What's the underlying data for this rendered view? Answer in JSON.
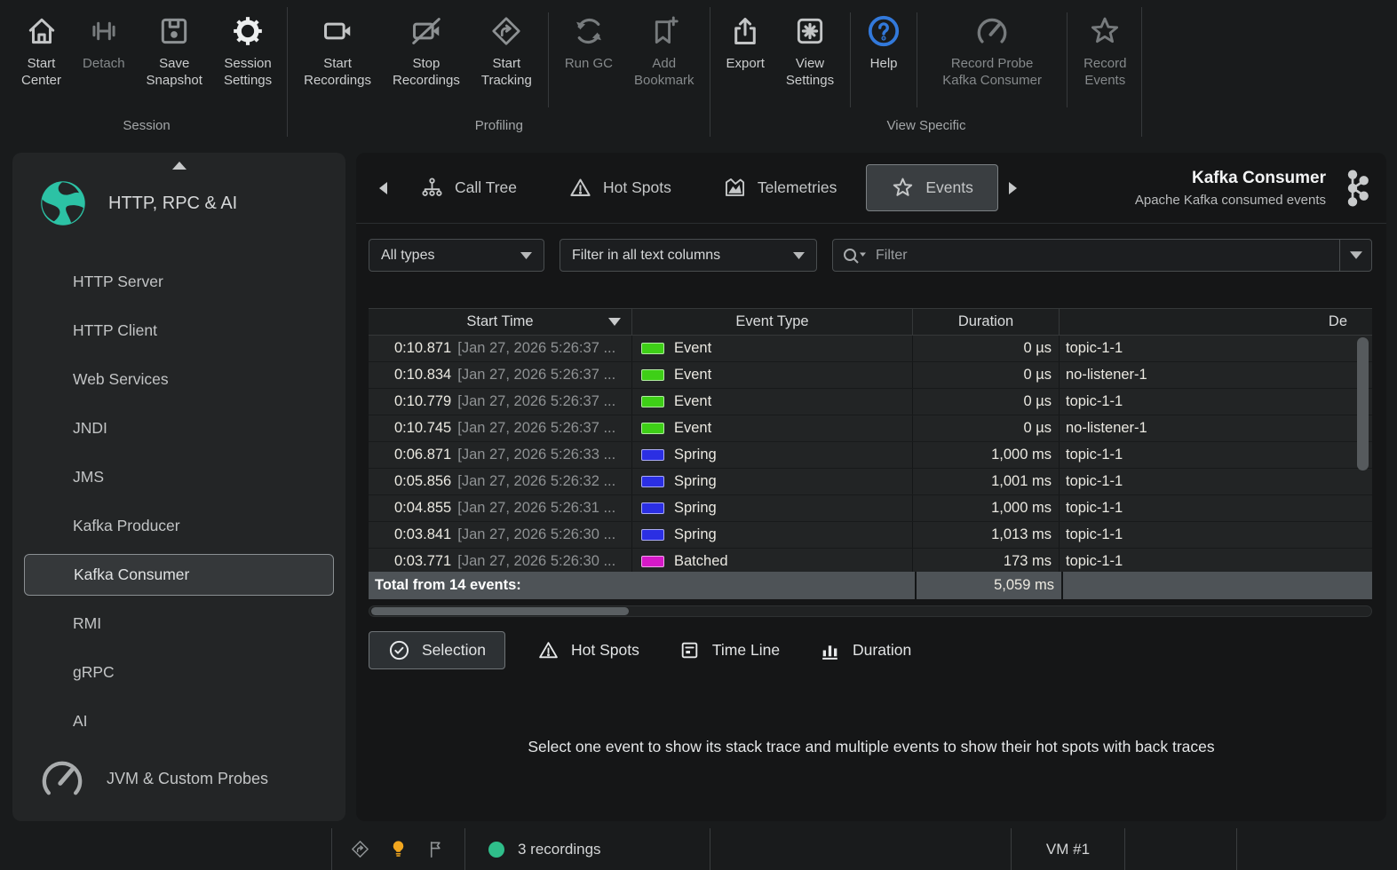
{
  "toolbar": {
    "groups": [
      {
        "label": "Session",
        "buttons": [
          {
            "label": "Start Center",
            "icon": "home-icon",
            "enabled": true
          },
          {
            "label": "Detach",
            "icon": "detach-icon",
            "enabled": false,
            "nowrap": true
          },
          {
            "label": "Save Snapshot",
            "icon": "save-snapshot-icon",
            "enabled": true,
            "icon_dim": true
          },
          {
            "label": "Session Settings",
            "icon": "gear-icon",
            "enabled": true,
            "highlight": true
          }
        ]
      },
      {
        "label": "Profiling",
        "buttons": [
          {
            "label": "Start Recordings",
            "icon": "start-recordings-icon",
            "enabled": true
          },
          {
            "label": "Stop Recordings",
            "icon": "stop-recordings-icon",
            "enabled": true,
            "icon_dim": true
          },
          {
            "label": "Start Tracking",
            "icon": "start-tracking-icon",
            "enabled": true,
            "icon_dim": true,
            "divider_after": true
          },
          {
            "label": "Run GC",
            "icon": "run-gc-icon",
            "enabled": false,
            "nowrap": true
          },
          {
            "label": "Add Bookmark",
            "icon": "add-bookmark-icon",
            "enabled": false
          }
        ]
      },
      {
        "label": "View Specific",
        "buttons": [
          {
            "label": "Export",
            "icon": "export-icon",
            "enabled": true,
            "nowrap": true
          },
          {
            "label": "View Settings",
            "icon": "view-settings-icon",
            "enabled": true,
            "divider_after": true
          },
          {
            "label": "Help",
            "icon": "help-icon",
            "enabled": true,
            "nowrap": true,
            "help_blue": true,
            "divider_after": true
          },
          {
            "label": "Record Probe Kafka Consumer",
            "icon": "record-probe-icon",
            "enabled": false,
            "wide": true,
            "divider_after": true
          },
          {
            "label": "Record Events",
            "icon": "record-events-icon",
            "enabled": false
          }
        ]
      }
    ]
  },
  "sidebar": {
    "title": "HTTP, RPC & AI",
    "title_icon": "globe-icon",
    "items": [
      {
        "label": "HTTP Server"
      },
      {
        "label": "HTTP Client"
      },
      {
        "label": "Web Services"
      },
      {
        "label": "JNDI"
      },
      {
        "label": "JMS"
      },
      {
        "label": "Kafka Producer"
      },
      {
        "label": "Kafka Consumer",
        "selected": true
      },
      {
        "label": "RMI"
      },
      {
        "label": "gRPC"
      },
      {
        "label": "AI"
      }
    ],
    "footer": {
      "label": "JVM & Custom Probes",
      "icon": "gauge-icon"
    }
  },
  "view": {
    "tabs": [
      {
        "label": "Call Tree",
        "icon": "call-tree-icon"
      },
      {
        "label": "Hot Spots",
        "icon": "warning-icon"
      },
      {
        "label": "Telemetries",
        "icon": "telemetries-icon"
      },
      {
        "label": "Events",
        "icon": "star-icon",
        "selected": true
      }
    ],
    "title": "Kafka Consumer",
    "subtitle": "Apache Kafka consumed events",
    "title_icon": "kafka-icon"
  },
  "filters": {
    "type_select": "All types",
    "column_select": "Filter in all text columns",
    "search_placeholder": "Filter"
  },
  "table": {
    "columns": [
      "Start Time",
      "Event Type",
      "Duration",
      "De"
    ],
    "sort_column": "Start Time",
    "type_colors": {
      "Event": "#3ecf17",
      "Spring": "#2b2fe3",
      "Batched": "#d619c8"
    },
    "rows": [
      {
        "time": "0:10.871",
        "date": "[Jan 27, 2026 5:26:37 ...",
        "type": "Event",
        "duration": "0 µs",
        "description": "topic-1-1"
      },
      {
        "time": "0:10.834",
        "date": "[Jan 27, 2026 5:26:37 ...",
        "type": "Event",
        "duration": "0 µs",
        "description": "no-listener-1"
      },
      {
        "time": "0:10.779",
        "date": "[Jan 27, 2026 5:26:37 ...",
        "type": "Event",
        "duration": "0 µs",
        "description": "topic-1-1"
      },
      {
        "time": "0:10.745",
        "date": "[Jan 27, 2026 5:26:37 ...",
        "type": "Event",
        "duration": "0 µs",
        "description": "no-listener-1"
      },
      {
        "time": "0:06.871",
        "date": "[Jan 27, 2026 5:26:33 ...",
        "type": "Spring",
        "duration": "1,000 ms",
        "description": "topic-1-1"
      },
      {
        "time": "0:05.856",
        "date": "[Jan 27, 2026 5:26:32 ...",
        "type": "Spring",
        "duration": "1,001 ms",
        "description": "topic-1-1"
      },
      {
        "time": "0:04.855",
        "date": "[Jan 27, 2026 5:26:31 ...",
        "type": "Spring",
        "duration": "1,000 ms",
        "description": "topic-1-1"
      },
      {
        "time": "0:03.841",
        "date": "[Jan 27, 2026 5:26:30 ...",
        "type": "Spring",
        "duration": "1,013 ms",
        "description": "topic-1-1"
      },
      {
        "time": "0:03.771",
        "date": "[Jan 27, 2026 5:26:30 ...",
        "type": "Batched",
        "duration": "173 ms",
        "description": "topic-1-1"
      }
    ],
    "total": {
      "label": "Total from 14 events:",
      "duration": "5,059 ms"
    }
  },
  "bottom_tabs": [
    {
      "label": "Selection",
      "icon": "check-circle-icon",
      "selected": true
    },
    {
      "label": "Hot Spots",
      "icon": "warning-icon"
    },
    {
      "label": "Time Line",
      "icon": "timeline-icon"
    },
    {
      "label": "Duration",
      "icon": "bar-chart-icon"
    }
  ],
  "message": "Select one event to show its stack trace and multiple events to show their hot spots with back traces",
  "status_bar": {
    "icons": [
      "tracking-icon",
      "bulb-icon",
      "flag-icon"
    ],
    "recordings": {
      "dot_color": "#2fbe8a",
      "label": "3 recordings"
    },
    "vm_label": "VM #1"
  },
  "colors": {
    "accent_teal": "#2cc2a5",
    "help_blue": "#3279db",
    "bulb_orange": "#f2a71f",
    "event_green": "#3ecf17",
    "spring_blue": "#2b2fe3",
    "batched_magenta": "#d619c8"
  }
}
